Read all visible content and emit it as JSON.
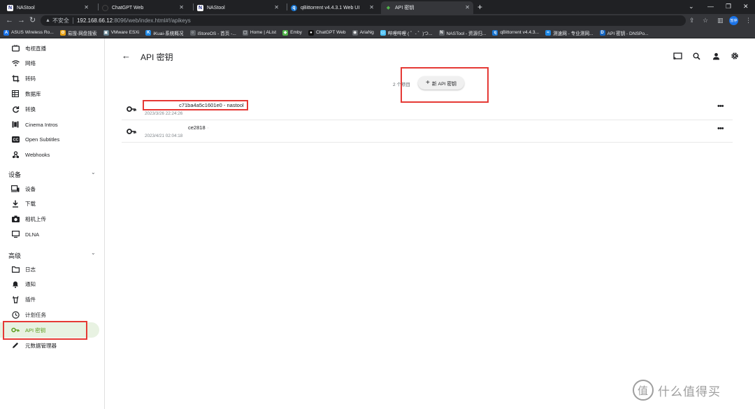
{
  "browser": {
    "tabs": [
      {
        "title": "NAStool",
        "icon": "N",
        "active": false
      },
      {
        "title": "ChatGPT Web",
        "icon": "●",
        "active": false
      },
      {
        "title": "NAStool",
        "icon": "N",
        "active": false
      },
      {
        "title": "qBittorrent v4.4.3.1 Web UI",
        "icon": "q",
        "active": false
      },
      {
        "title": "API 密钥",
        "icon": "◆",
        "active": true
      }
    ],
    "new_tab": "+",
    "address": {
      "security": "不安全",
      "host": "192.168.66.12",
      "path": ":8096/web/index.html#!/apikeys"
    },
    "profile": "暂停",
    "bookmarks": [
      {
        "label": "ASUS Wireless Ro...",
        "icon_color": "#1a73e8",
        "icon": "A"
      },
      {
        "label": "易搜-网盘搜索",
        "icon_color": "#e8a317",
        "icon": "✿"
      },
      {
        "label": "VMware ESXi",
        "icon_color": "#607d8b",
        "icon": "▣"
      },
      {
        "label": "iKuai-系统概况",
        "icon_color": "#1e88e5",
        "icon": "K"
      },
      {
        "label": "iStoreOS - 首页 -...",
        "icon_color": "#5f6368",
        "icon": "○"
      },
      {
        "label": "Home | AList",
        "icon_color": "#5f6368",
        "icon": "▢"
      },
      {
        "label": "Emby",
        "icon_color": "#52b54b",
        "icon": "◆"
      },
      {
        "label": "ChatGPT Web",
        "icon_color": "#111111",
        "icon": "●"
      },
      {
        "label": "AriaNg",
        "icon_color": "#5f6368",
        "icon": "◉"
      },
      {
        "label": "哔哩哔哩 ( ゜- ゜)つ...",
        "icon_color": "#4fc3f7",
        "icon": "▭"
      },
      {
        "label": "NASTool - 资源归...",
        "icon_color": "#5f6368",
        "icon": "N"
      },
      {
        "label": "qBittorrent v4.4.3...",
        "icon_color": "#1976d2",
        "icon": "q"
      },
      {
        "label": "测速网 - 专业测网...",
        "icon_color": "#1e88e5",
        "icon": "≈"
      },
      {
        "label": "API 密钥 - DNSPo...",
        "icon_color": "#1565c0",
        "icon": "D"
      }
    ]
  },
  "sidebar": {
    "top_items": [
      {
        "label": "电视直播",
        "icon": "live-tv-icon"
      },
      {
        "label": "网络",
        "icon": "wifi-icon"
      },
      {
        "label": "转码",
        "icon": "crop-icon"
      },
      {
        "label": "数据库",
        "icon": "database-icon"
      },
      {
        "label": "转换",
        "icon": "sync-icon"
      },
      {
        "label": "Cinema Intros",
        "icon": "movie-icon"
      },
      {
        "label": "Open Subtitles",
        "icon": "cc-icon"
      },
      {
        "label": "Webhooks",
        "icon": "webhook-icon"
      }
    ],
    "devices_heading": "设备",
    "device_items": [
      {
        "label": "设备",
        "icon": "devices-icon"
      },
      {
        "label": "下载",
        "icon": "download-icon"
      },
      {
        "label": "相机上传",
        "icon": "camera-icon"
      },
      {
        "label": "DLNA",
        "icon": "dlna-icon"
      }
    ],
    "advanced_heading": "高级",
    "advanced_items": [
      {
        "label": "日志",
        "icon": "folder-icon"
      },
      {
        "label": "通知",
        "icon": "bell-icon"
      },
      {
        "label": "插件",
        "icon": "plugin-icon"
      },
      {
        "label": "计划任务",
        "icon": "clock-icon"
      },
      {
        "label": "API 密钥",
        "icon": "key-icon",
        "active": true
      },
      {
        "label": "元数据管理器",
        "icon": "edit-icon"
      }
    ]
  },
  "main": {
    "title": "API 密钥",
    "count_text": "2 个项目",
    "new_button": "新 API 密钥",
    "keys": [
      {
        "token_obscured": "                   ",
        "token_visible": "c71ba4a5c1601e0",
        "app": "- nastool",
        "date": "2023/3/26 22:24:26"
      },
      {
        "token_obscured": "                        ",
        "token_visible": "ce2818",
        "app": " -        ",
        "date": "2023/4/21 02:04:18"
      }
    ]
  },
  "watermark": {
    "text": "什么值得买",
    "logo": "值"
  },
  "colors": {
    "accent": "#52b54b",
    "highlight": "#e53935"
  }
}
